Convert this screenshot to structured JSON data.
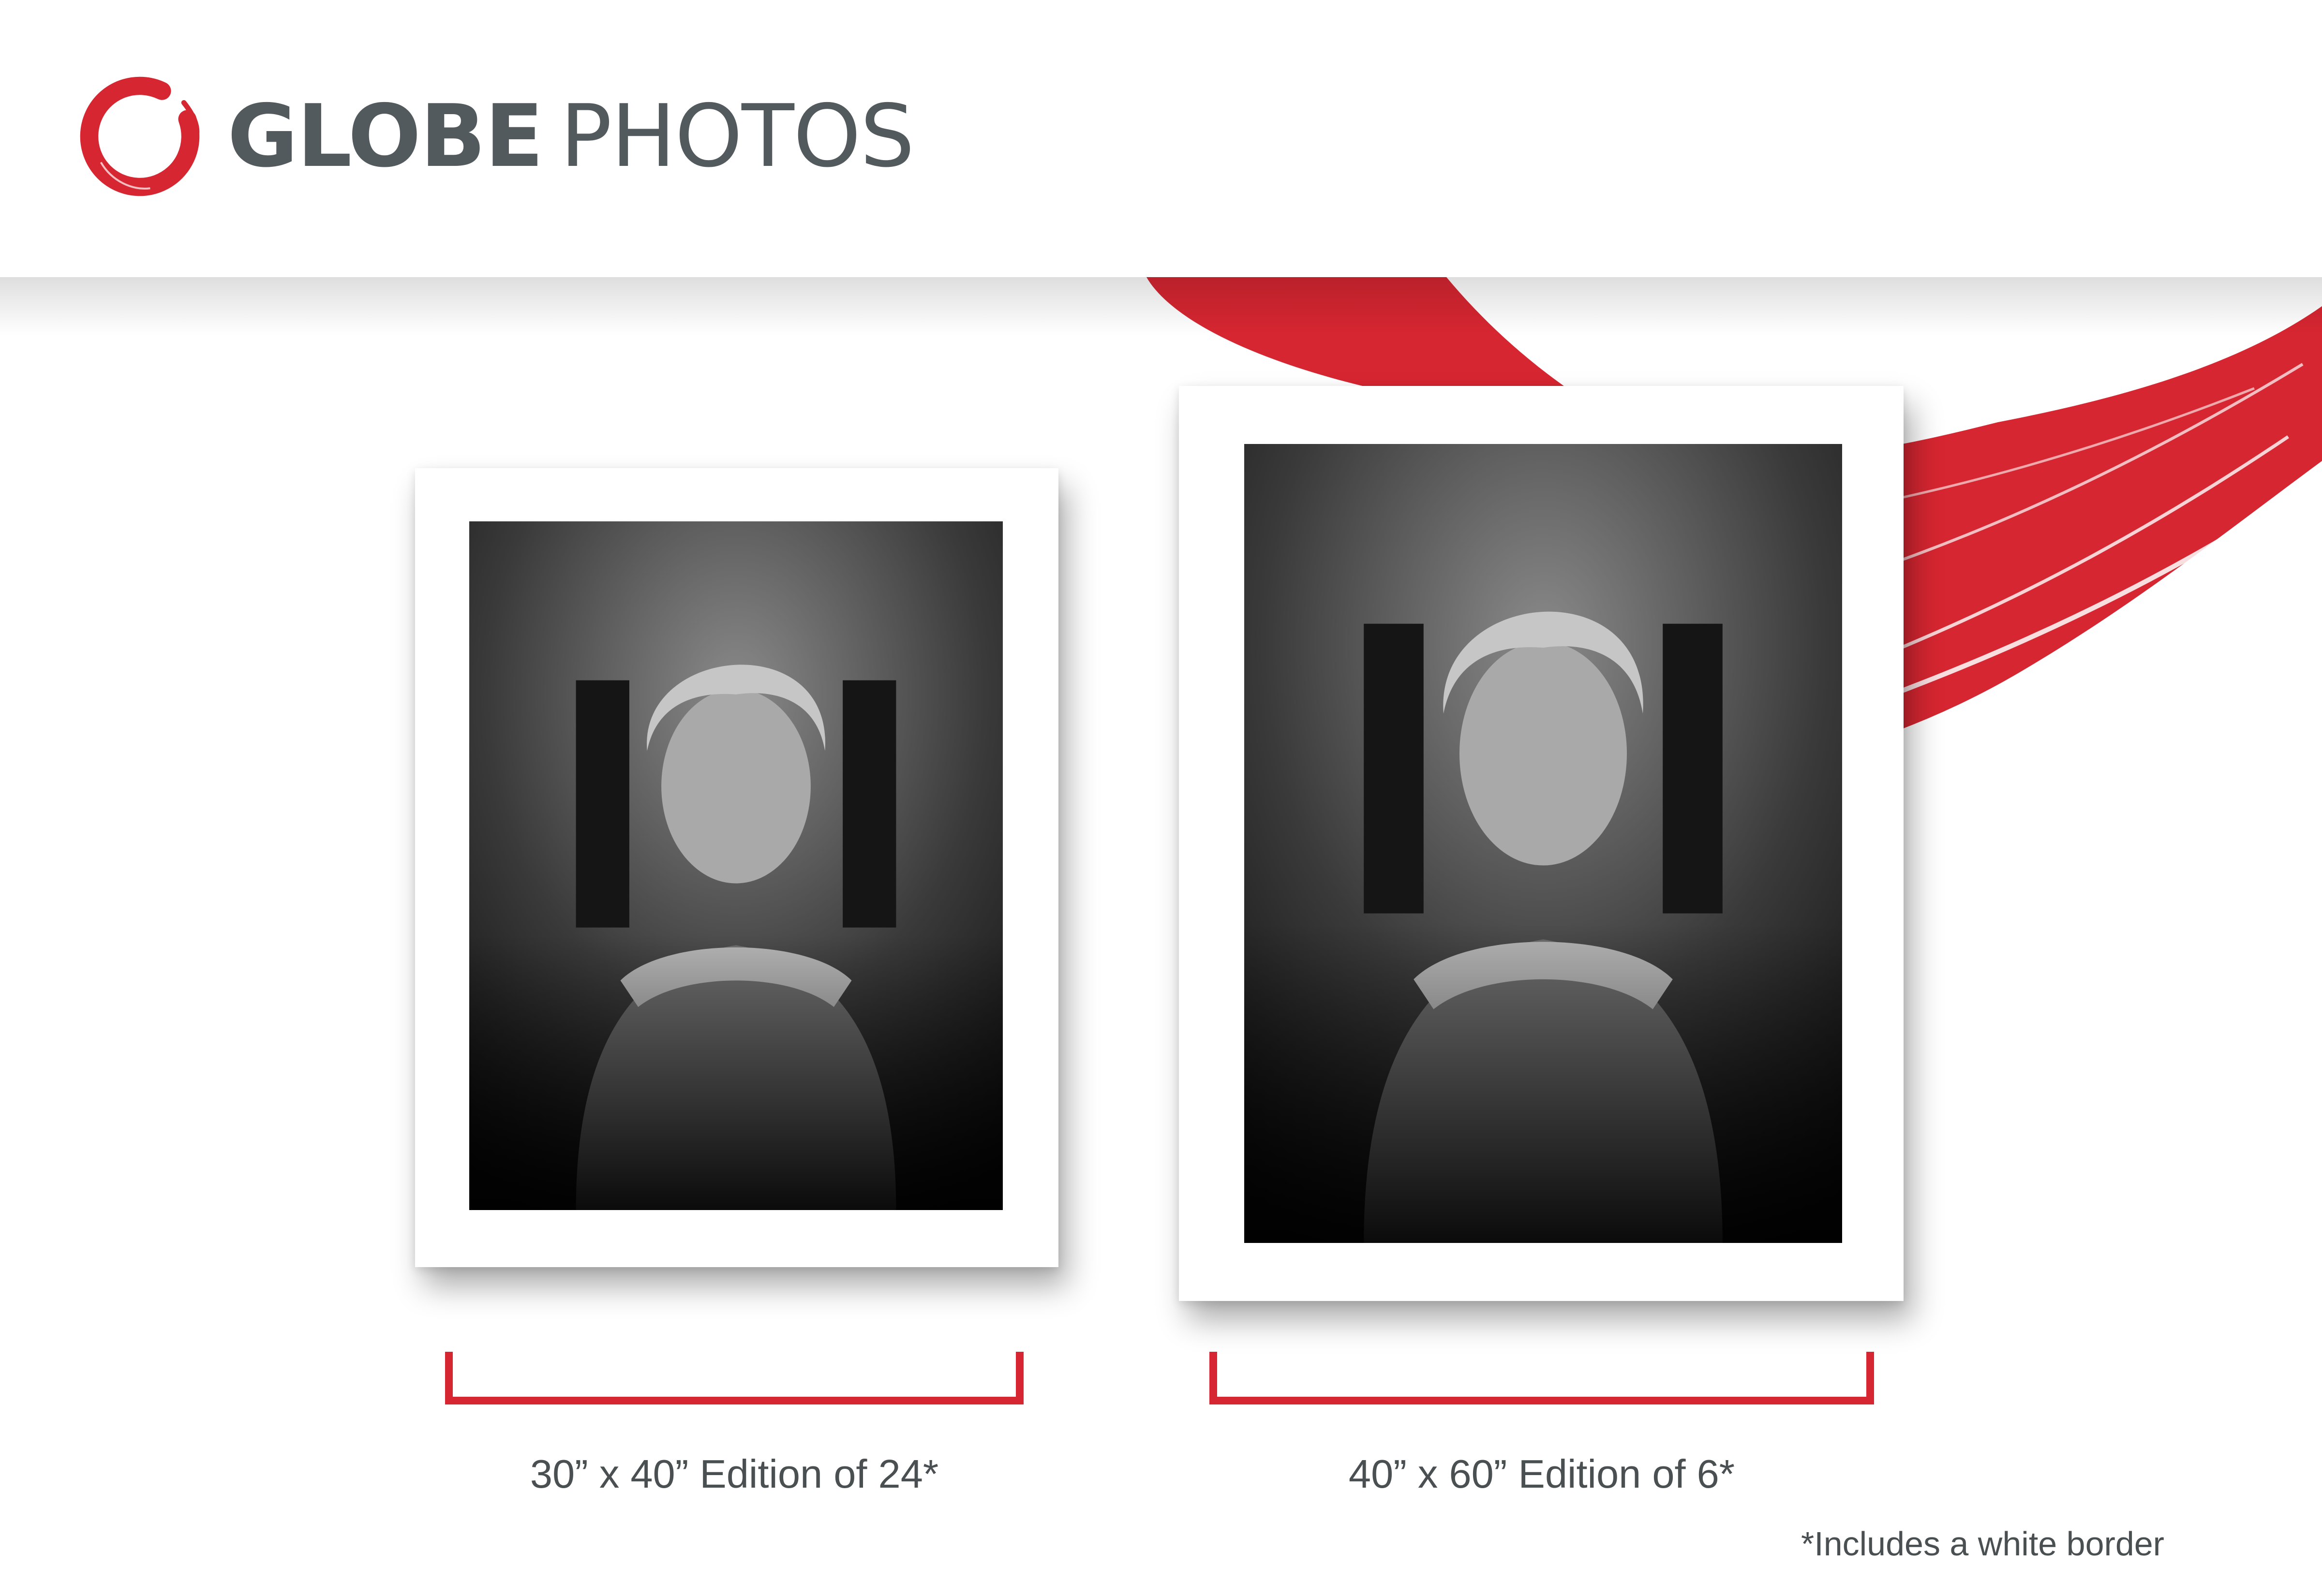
{
  "brand": {
    "name_strong": "GLOBE",
    "name_light": "PHOTOS",
    "accent_color": "#d62631",
    "text_color": "#525a5e"
  },
  "prints": [
    {
      "caption": "30” x 40” Edition of 24*",
      "photo": "black-and-white portrait of a woman resting her chin on her hands"
    },
    {
      "caption": "40” x 60” Edition of 6*",
      "photo": "black-and-white portrait of a woman resting her chin on her hands"
    }
  ],
  "footnote": "*Includes a white border"
}
